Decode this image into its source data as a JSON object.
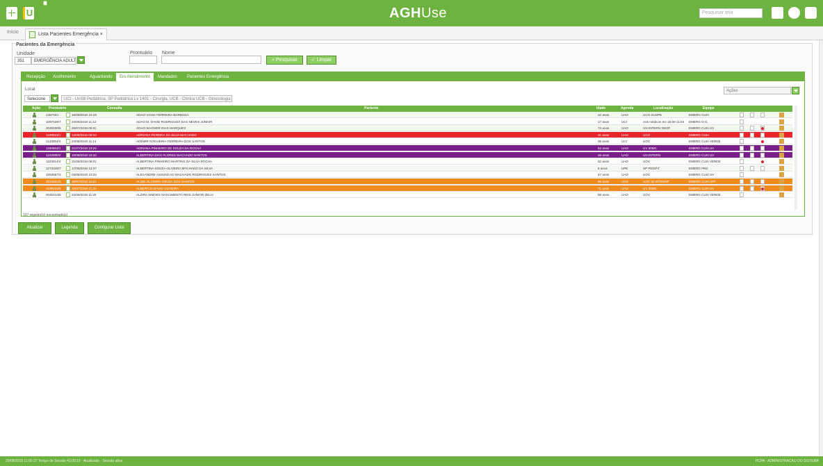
{
  "app": {
    "brand_main": "AGH",
    "brand_sub": "Use",
    "search_placeholder": "Pesquisar tela"
  },
  "tabs": {
    "home": "Início",
    "active": "Lista Pacientes Emergência"
  },
  "panel": {
    "title": "Pacientes da Emergência",
    "unidade_label": "Unidade",
    "unidade_code": "351",
    "unidade_value": "EMERGÊNCIA ADULTO",
    "prontuario_label": "Prontuário",
    "nome_label": "Nome",
    "pesquisar": "Pesquisar",
    "limpar": "Limpar"
  },
  "inner_tabs": [
    "Recepção",
    "Acolhimento",
    "Aguardando",
    "Em Atendimento",
    "Mandados",
    "Pacientes Emergência"
  ],
  "filter": {
    "local_label": "Local",
    "local_value": "Selecione",
    "local_chips": "UCI - UnSB Pediátrica, SP Pediátrica Lv 1401 - Cirurgia, UCB - Clínica UCB - Ginecologia",
    "acoes": "Ações"
  },
  "grid": {
    "headers": [
      "Ação",
      "Prontuário",
      "Consulta",
      "Paciente",
      "Idade",
      "Agenda",
      "Localização",
      "Equipe"
    ],
    "rows": [
      {
        "style": "alt",
        "pront": "1457204",
        "data": "19/08/2018 10:19",
        "nome": "ADAO VIANA FERREIRA BARBOSA",
        "idade": "22 anos",
        "agenda": "UAO",
        "local": "UCO SUSPE",
        "equipe": "EMERG GUIA",
        "dot": false
      },
      {
        "style": "",
        "pront": "1097539/7",
        "data": "24/08/2018 11:12",
        "nome": "ADAO M. DAVID RODRIGUES DAS NEVES JUNIOR",
        "idade": "17 anos",
        "agenda": "UCI",
        "local": "Aos médicos em 15:08 11:04",
        "equipe": "EMERG O.G.",
        "dot": false
      },
      {
        "style": "alt",
        "pront": "2040030/5",
        "data": "26/07/2018 05:51",
        "nome": "ADAO WAGNER DIAS MARQUES",
        "idade": "74 anos",
        "agenda": "UAO",
        "local": "UN INTERN 3002F",
        "equipe": "EMERG CLIN UV",
        "dot": true
      },
      {
        "style": "red",
        "pront": "1198033/1",
        "data": "12/08/2018 09:22",
        "nome": "ADRIANA PEREIRA DA SILVA MACHADO",
        "idade": "31 anos",
        "agenda": "UAO",
        "local": "UCO",
        "equipe": "EMERG GUIA",
        "dot": false
      },
      {
        "style": "",
        "pront": "1133054/4",
        "data": "24/08/2018 11:14",
        "nome": "ADEMIR NOGUEIRA FERREIRA DOS SANTOS",
        "idade": "36 anos",
        "agenda": "UCI",
        "local": "UOV",
        "equipe": "EMERG CLIN VERDE",
        "dot": true
      },
      {
        "style": "purple",
        "pront": "1190653/1",
        "data": "21/07/2018 10:24",
        "nome": "ADRIANA PINHEIRO DE SOUZA DA ROCHA",
        "idade": "52 anos",
        "agenda": "UAO",
        "local": "UV 30MC",
        "equipe": "EMERG CLIN UV",
        "dot": false
      },
      {
        "style": "purple",
        "pront": "1102080/3",
        "data": "10/08/2018 16:34",
        "nome": "ALBERTINA DIAS FLORES MACHADO SANTOS",
        "idade": "46 anos",
        "agenda": "UAO",
        "local": "UN INTERN",
        "equipe": "EMERG CLIN UV",
        "dot": false
      },
      {
        "style": "",
        "pront": "1103014/4",
        "data": "31/08/2018 06:01",
        "nome": "ALBERTINA PINHEIRO MARTINS DA SILVA ROCHA",
        "idade": "52 anos",
        "agenda": "UAO",
        "local": "UOV",
        "equipe": "EMERG CLIN VERDE",
        "dot": true
      },
      {
        "style": "alt",
        "pront": "1272045/7",
        "data": "17/08/2018 14:37",
        "nome": "ALBERTINA SOUZA OLIVEIRA MACHADO DA SILVA",
        "idade": "5 anos",
        "agenda": "UPE",
        "local": "SP PEDIÁT",
        "equipe": "EMERG PED",
        "dot": false
      },
      {
        "style": "",
        "pront": "1053557/2",
        "data": "03/08/2018 10:33",
        "nome": "ALEXANDRE ASSUNCAO MACHADO RODRIGUES SANTOS",
        "idade": "47 anos",
        "agenda": "UAO",
        "local": "UOV",
        "equipe": "EMERG CLIN UV",
        "dot": false
      },
      {
        "style": "orange",
        "pront": "2024621/5",
        "data": "29/07/2018 10:21",
        "nome": "ALINE OLIVEIRA SOUZA DOS SANTOS",
        "idade": "56 anos",
        "agenda": "UAO",
        "local": "UOC 32 INTERNF",
        "equipe": "EMERG CLIN UPF",
        "dot": false
      },
      {
        "style": "orange",
        "pront": "2198183/5",
        "data": "30/07/2018 21:34",
        "nome": "ALBERICIA DAVID OLIVEIRA",
        "idade": "71 anos",
        "agenda": "UAO",
        "local": "UV 30MC",
        "equipe": "EMERG CLIN UV",
        "dot": true
      },
      {
        "style": "",
        "pront": "2040414/5",
        "data": "22/08/2018 11:29",
        "nome": "ALZIRA SIMOES NASCIMENTO REIS JUNIOR ZELIA",
        "idade": "58 anos",
        "agenda": "UAO",
        "local": "UOV",
        "equipe": "EMERG CLIN VERDE",
        "dot": false
      }
    ],
    "count": "197 registro(s) encontrado(s)"
  },
  "bottom_buttons": [
    "Atualizar",
    "Legenda",
    "Configurar Lista"
  ],
  "footer": {
    "left": "29/08/2018 11:05:37 Tempo de Sessão 41:00:19 · Atualizado · Sessão ativa",
    "right": "HCPA - ADMINISTRACAO DO SISTEMA"
  }
}
